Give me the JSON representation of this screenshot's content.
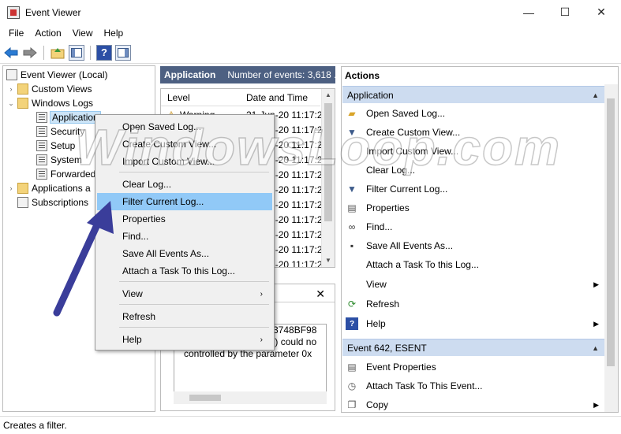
{
  "window": {
    "title": "Event Viewer",
    "controls": [
      "—",
      "☐",
      "✕"
    ]
  },
  "menu": [
    "File",
    "Action",
    "View",
    "Help"
  ],
  "tree": {
    "root": "Event Viewer (Local)",
    "custom_views": "Custom Views",
    "windows_logs": "Windows Logs",
    "logs": [
      "Application",
      "Security",
      "Setup",
      "System",
      "Forwarded"
    ],
    "apps_services": "Applications a",
    "subscriptions": "Subscriptions"
  },
  "middle": {
    "log_name": "Application",
    "event_count": "Number of events: 3,618 ...",
    "columns": [
      "Level",
      "Date and Time"
    ],
    "rows": [
      {
        "level": "Warning",
        "time": "21-Jun-20 11:17:2"
      },
      {
        "level": "",
        "time": "21-Jun-20 11:17:2"
      },
      {
        "level": "",
        "time": "21-Jun-20 11:17:2"
      },
      {
        "level": "",
        "time": "21-Jun-20 11:17:2"
      },
      {
        "level": "",
        "time": "21-Jun-20 11:17:2"
      },
      {
        "level": "",
        "time": "21-Jun-20 11:17:2"
      },
      {
        "level": "",
        "time": "21-Jun-20 11:17:2"
      },
      {
        "level": "",
        "time": "21-Jun-20 11:17:2"
      },
      {
        "level": "",
        "time": "21-Jun-20 11:17:2"
      },
      {
        "level": "",
        "time": "21-Jun-20 11:17:2"
      },
      {
        "level": "",
        "time": "21-Jun-20 11:17:2"
      }
    ],
    "detail_lines": [
      "3748BF98",
      "version 9080 (0x2378) could no",
      "controlled by the parameter 0x"
    ]
  },
  "actions": {
    "title": "Actions",
    "group1": "Application",
    "group1_items": [
      {
        "label": "Open Saved Log...",
        "icon": "open-folder-icon"
      },
      {
        "label": "Create Custom View...",
        "icon": "filter-icon"
      },
      {
        "label": "Import Custom View...",
        "icon": ""
      },
      {
        "label": "Clear Log...",
        "icon": ""
      },
      {
        "label": "Filter Current Log...",
        "icon": "filter-icon"
      },
      {
        "label": "Properties",
        "icon": "properties-icon"
      },
      {
        "label": "Find...",
        "icon": "binoculars-icon"
      },
      {
        "label": "Save All Events As...",
        "icon": "save-icon"
      },
      {
        "label": "Attach a Task To this Log...",
        "icon": ""
      },
      {
        "label": "View",
        "icon": ""
      },
      {
        "label": "Refresh",
        "icon": "refresh-icon"
      },
      {
        "label": "Help",
        "icon": "help-icon"
      }
    ],
    "group2": "Event 642, ESENT",
    "group2_items": [
      {
        "label": "Event Properties",
        "icon": "properties-icon"
      },
      {
        "label": "Attach Task To This Event...",
        "icon": "task-icon"
      },
      {
        "label": "Copy",
        "icon": "copy-icon"
      }
    ]
  },
  "context_menu": {
    "items": [
      "Open Saved Log...",
      "Create Custom View...",
      "Import Custom View...",
      "Clear Log...",
      "Filter Current Log...",
      "Properties",
      "Find...",
      "Save All Events As...",
      "Attach a Task To this Log...",
      "View",
      "Refresh",
      "Help"
    ]
  },
  "status": "Creates a filter.",
  "watermark": "WindowsLoop.com",
  "colors": {
    "header_bg": "#4d6082",
    "group_bg": "#cddcf0",
    "highlight": "#91c9f7",
    "arrow": "#3a3d9a"
  }
}
